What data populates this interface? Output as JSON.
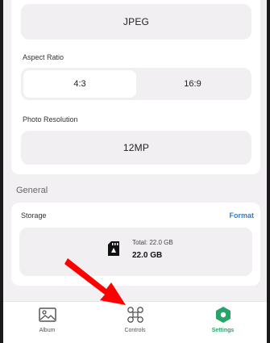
{
  "format": {
    "selected": "JPEG"
  },
  "aspect_ratio": {
    "label": "Aspect Ratio",
    "options": [
      "4:3",
      "16:9"
    ],
    "selected": "4:3"
  },
  "photo_resolution": {
    "label": "Photo Resolution",
    "value": "12MP"
  },
  "general": {
    "title": "General",
    "storage": {
      "label": "Storage",
      "format_link": "Format",
      "total": "Total: 22.0 GB",
      "value": "22.0 GB",
      "icon": "sd-card-icon"
    }
  },
  "nav": {
    "items": [
      {
        "label": "Album",
        "icon": "image-icon"
      },
      {
        "label": "Controls",
        "icon": "drone-icon"
      },
      {
        "label": "Settings",
        "icon": "settings-hexagon-icon",
        "active": true
      }
    ]
  },
  "colors": {
    "accent": "#2aa36b",
    "link": "#2e7cd6",
    "annotation_arrow": "#ff0000"
  }
}
